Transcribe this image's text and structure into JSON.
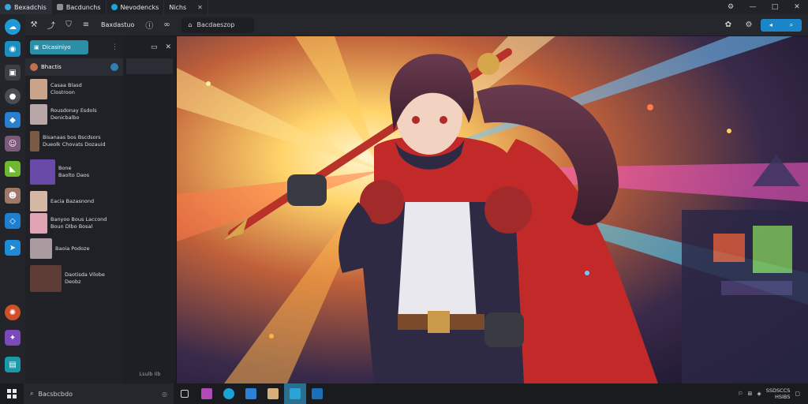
{
  "titlebar": {
    "tabs": [
      {
        "label": "Bexadchis",
        "active": true
      },
      {
        "label": "Bacdunchs",
        "active": false
      },
      {
        "label": "Nevodencks",
        "active": false
      },
      {
        "label": "Nichs",
        "active": false
      }
    ],
    "close_glyph": "✕",
    "controls": [
      "⚙",
      "—",
      "□",
      "✕"
    ]
  },
  "toolbar": {
    "title": "Baxdastuo",
    "url_text": "Bacdaeszop",
    "toggle": [
      "◂",
      "⌕"
    ]
  },
  "panel": {
    "header_button": "Dicasiniyo",
    "section_label": "Bhactis",
    "chats": [
      {
        "line1": "Casaa Blasd",
        "line2": "Clostroon",
        "color": "#c9a38a"
      },
      {
        "line1": "Rousdonay Esdols",
        "line2": "Denicbalbo",
        "color": "#b9a7a8"
      },
      {
        "line1": "Bisanaas bos Bscdsors",
        "line2": "Dueolk Chovats Dozauid",
        "color": "#7a5a44"
      },
      {
        "line1": "Bone",
        "line2": "Baolto Daos",
        "color": "#6a4aa8"
      },
      {
        "line1": "Eacia Bazasnond",
        "line2": "",
        "color": "#d6b7a4"
      },
      {
        "line1": "Banyoo Bous Laccond",
        "line2": "Boun Dlbo Bosal",
        "color": "#e0a3b4"
      },
      {
        "line1": "Baoia Podoze",
        "line2": "",
        "color": "#a99aa0"
      },
      {
        "line1": "Daotisda Vilobe",
        "line2": "Deobz",
        "color": "#5d3c36"
      }
    ]
  },
  "side": {
    "status": "Lsulb   Ilb"
  },
  "taskbar": {
    "search_text": "Bacsbcbdo",
    "time": "SSDSCCS",
    "date": "HSIBS"
  },
  "colors": {
    "accent": "#1a86c8",
    "panel_button": "#2c8fa8"
  }
}
